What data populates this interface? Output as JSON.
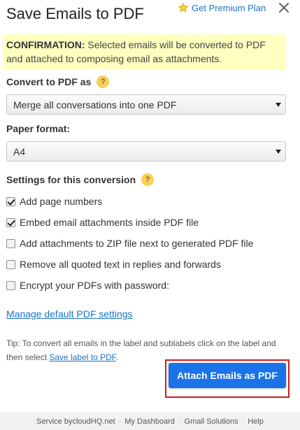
{
  "header": {
    "title": "Save Emails to PDF",
    "premium_label": "Get Premium Plan",
    "premium_icon": "star-icon",
    "close_icon": "close-icon"
  },
  "confirmation": {
    "prefix": "CONFIRMATION:",
    "text": " Selected emails will be converted to PDF and attached to composing email as attachments."
  },
  "convert": {
    "label": "Convert to PDF as",
    "help_glyph": "?",
    "selected": "Merge all conversations into one PDF"
  },
  "paper": {
    "label": "Paper format:",
    "selected": "A4"
  },
  "settings": {
    "label": "Settings for this conversion",
    "help_glyph": "?",
    "options": [
      {
        "label": "Add page numbers",
        "checked": true
      },
      {
        "label": "Embed email attachments inside PDF file",
        "checked": true
      },
      {
        "label": "Add attachments to ZIP file next to generated PDF file",
        "checked": false
      },
      {
        "label": "Remove all quoted text in replies and forwards",
        "checked": false
      },
      {
        "label": "Encrypt your PDFs with password:",
        "checked": false
      }
    ]
  },
  "manage_link": "Manage default PDF settings",
  "tip": {
    "prefix": "Tip: To convert all emails in the label and sublabels click on the label and then select ",
    "link": "Save label to PDF",
    "suffix": "."
  },
  "primary_button": "Attach Emails as PDF",
  "footer": {
    "service_prefix": "Service by ",
    "service_link": "cloudHQ.net",
    "separator": "·",
    "dashboard": "My Dashboard",
    "solutions": "Gmail Solutions",
    "help": "Help"
  },
  "colors": {
    "accent": "#1a73e8",
    "confirmation_bg": "#ffffc0",
    "highlight_border": "#d11a1a"
  }
}
